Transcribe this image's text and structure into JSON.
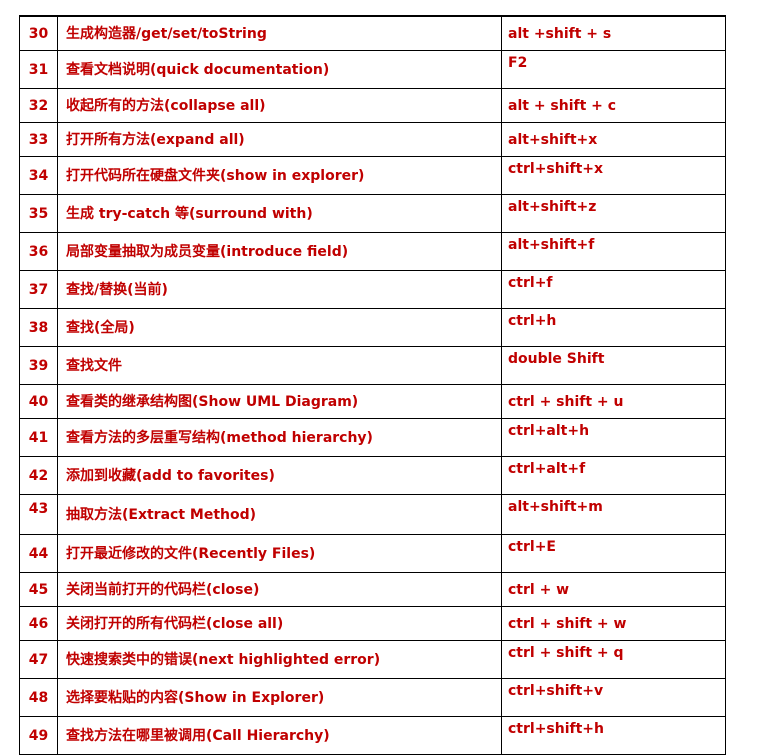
{
  "table": {
    "rows": [
      {
        "num": "30",
        "desc": "生成构造器/get/set/toString",
        "key": "alt +shift + s"
      },
      {
        "num": "31",
        "desc": "查看文档说明(quick documentation)",
        "key": "F2"
      },
      {
        "num": "32",
        "desc": "收起所有的方法(collapse all)",
        "key": "alt + shift + c"
      },
      {
        "num": "33",
        "desc": "打开所有方法(expand all)",
        "key": "alt+shift+x"
      },
      {
        "num": "34",
        "desc": "打开代码所在硬盘文件夹(show in explorer)",
        "key": "ctrl+shift+x"
      },
      {
        "num": "35",
        "desc": "生成 try-catch 等(surround with)",
        "key": "alt+shift+z"
      },
      {
        "num": "36",
        "desc": "局部变量抽取为成员变量(introduce field)",
        "key": "alt+shift+f"
      },
      {
        "num": "37",
        "desc": "查找/替换(当前)",
        "key": "ctrl+f"
      },
      {
        "num": "38",
        "desc": "查找(全局)",
        "key": "ctrl+h"
      },
      {
        "num": "39",
        "desc": "查找文件",
        "key": "double Shift"
      },
      {
        "num": "40",
        "desc": "查看类的继承结构图(Show UML Diagram)",
        "key": "ctrl + shift + u"
      },
      {
        "num": "41",
        "desc": "查看方法的多层重写结构(method hierarchy)",
        "key": "ctrl+alt+h"
      },
      {
        "num": "42",
        "desc": "添加到收藏(add to favorites)",
        "key": "ctrl+alt+f"
      },
      {
        "num": "43",
        "desc": "抽取方法(Extract Method)",
        "key": "alt+shift+m"
      },
      {
        "num": "44",
        "desc": "打开最近修改的文件(Recently Files)",
        "key": "ctrl+E"
      },
      {
        "num": "45",
        "desc": "关闭当前打开的代码栏(close)",
        "key": "ctrl + w"
      },
      {
        "num": "46",
        "desc": "关闭打开的所有代码栏(close all)",
        "key": "ctrl + shift + w"
      },
      {
        "num": "47",
        "desc": "快速搜索类中的错误(next highlighted error)",
        "key": "ctrl + shift + q"
      },
      {
        "num": "48",
        "desc": "选择要粘贴的内容(Show in Explorer)",
        "key": "ctrl+shift+v"
      },
      {
        "num": "49",
        "desc": "查找方法在哪里被调用(Call Hierarchy)",
        "key": "ctrl+shift+h"
      }
    ]
  },
  "colors": {
    "text": "#c00000",
    "border": "#000000",
    "background": "#ffffff"
  }
}
